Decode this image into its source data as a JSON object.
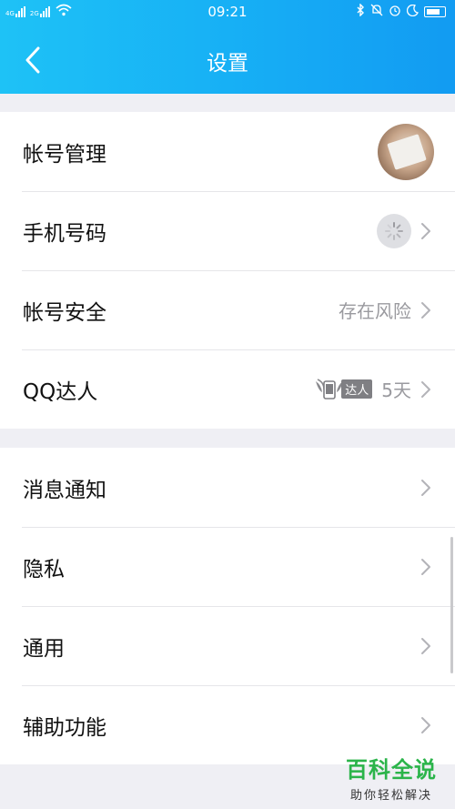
{
  "status_bar": {
    "time": "09:21",
    "left_icons": [
      "4g-signal-icon",
      "2g-signal-icon",
      "wifi-icon"
    ],
    "signal_labels": [
      "4G",
      "2G"
    ],
    "right_icons": [
      "bluetooth-icon",
      "mute-bell-icon",
      "alarm-icon",
      "moon-icon",
      "battery-icon"
    ]
  },
  "header": {
    "title": "设置",
    "back_icon": "chevron-left-icon"
  },
  "group1": [
    {
      "label": "帐号管理",
      "right": "avatar"
    },
    {
      "label": "手机号码",
      "right": "loading-spinner"
    },
    {
      "label": "帐号安全",
      "value": "存在风险"
    },
    {
      "label": "QQ达人",
      "badge": "达人",
      "value": "5天"
    }
  ],
  "group2": [
    {
      "label": "消息通知"
    },
    {
      "label": "隐私"
    },
    {
      "label": "通用"
    },
    {
      "label": "辅助功能"
    }
  ],
  "watermark": {
    "main": "百科全说",
    "sub": "助你轻松解决"
  },
  "colors": {
    "header_start": "#1ec2f6",
    "header_end": "#129bf2",
    "background": "#efeff4",
    "secondary_text": "#9a9a9f",
    "watermark_green": "#2bb44a"
  }
}
